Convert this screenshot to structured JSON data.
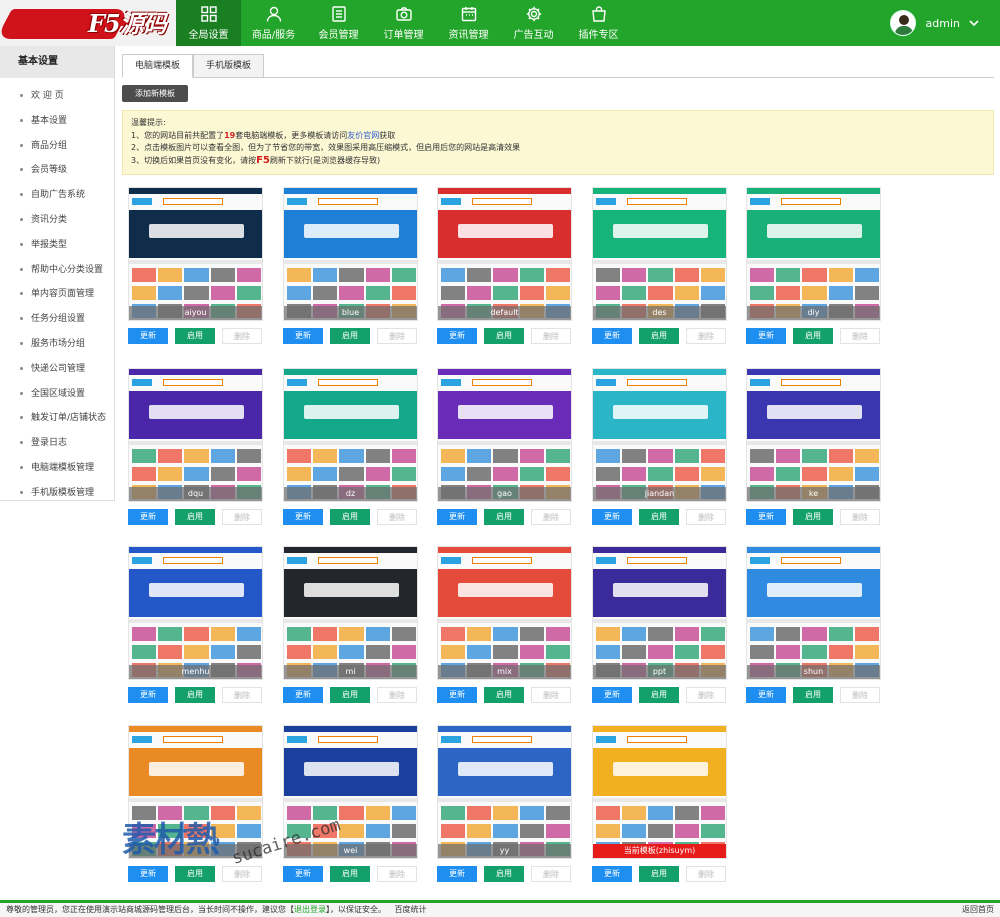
{
  "brand": {
    "logo_text": "F5源码"
  },
  "nav": [
    {
      "label": "全局设置",
      "icon": "grid-icon",
      "active": true
    },
    {
      "label": "商品/服务",
      "icon": "user-icon",
      "active": false
    },
    {
      "label": "会员管理",
      "icon": "document-list-icon",
      "active": false
    },
    {
      "label": "订单管理",
      "icon": "camera-icon",
      "active": false
    },
    {
      "label": "资讯管理",
      "icon": "calendar-icon",
      "active": false
    },
    {
      "label": "广告互动",
      "icon": "gear-icon",
      "active": false
    },
    {
      "label": "插件专区",
      "icon": "shopping-bag-icon",
      "active": false
    }
  ],
  "user": {
    "name": "admin"
  },
  "sidebar": {
    "title": "基本设置",
    "items": [
      "欢 迎 页",
      "基本设置",
      "商品分组",
      "会员等级",
      "自助广告系统",
      "资讯分类",
      "举报类型",
      "帮助中心分类设置",
      "单内容页面管理",
      "任务分组设置",
      "服务市场分组",
      "快递公司管理",
      "全国区域设置",
      "触发订单/店铺状态",
      "登录日志",
      "电脑端模板管理",
      "手机版模板管理"
    ]
  },
  "tabs": [
    "电脑端模板",
    "手机版模板"
  ],
  "add_button": "添加新模板",
  "tips": {
    "title": "温馨提示:",
    "l1_a": "1、您的网站目前共配置了",
    "l1_count": "19",
    "l1_b": "套电脑端模板，更多模板请访问",
    "l1_link": "友价官网",
    "l1_c": "获取",
    "l2": "2、点击模板图片可以查看全图，但为了节省您的带宽，效果图采用高压缩模式，但启用后您的网站是高清效果",
    "l3_a": "3、切换后如果首页没有变化，请按",
    "l3_key": "F5",
    "l3_b": "刷新下就行(是浏览器缓存导致)"
  },
  "buttons": {
    "update": "更新",
    "enable": "启用",
    "delete": "删除"
  },
  "templates": [
    {
      "name": "aiyou",
      "current": false,
      "color": "#0f2d4a"
    },
    {
      "name": "blue",
      "current": false,
      "color": "#1e7fd6"
    },
    {
      "name": "default",
      "current": false,
      "color": "#d92e2e"
    },
    {
      "name": "des",
      "current": false,
      "color": "#16b37a"
    },
    {
      "name": "diy",
      "current": false,
      "color": "#19b07a"
    },
    {
      "name": "dqu",
      "current": false,
      "color": "#4a26a8"
    },
    {
      "name": "dz",
      "current": false,
      "color": "#13a88a"
    },
    {
      "name": "gao",
      "current": false,
      "color": "#6a2bb8"
    },
    {
      "name": "jiandan",
      "current": false,
      "color": "#2bb6c8"
    },
    {
      "name": "ke",
      "current": false,
      "color": "#3a36b0"
    },
    {
      "name": "menhu",
      "current": false,
      "color": "#2458c8"
    },
    {
      "name": "mi",
      "current": false,
      "color": "#23262c"
    },
    {
      "name": "mix",
      "current": false,
      "color": "#e44b3a"
    },
    {
      "name": "ppt",
      "current": false,
      "color": "#3a2a9a"
    },
    {
      "name": "shun",
      "current": false,
      "color": "#2f8ae0"
    },
    {
      "name": "",
      "current": false,
      "color": "#e98a24"
    },
    {
      "name": "wei",
      "current": false,
      "color": "#1a3f9c"
    },
    {
      "name": "yy",
      "current": false,
      "color": "#2d65c4"
    },
    {
      "name": "当前模板(zhisuym)",
      "current": true,
      "color": "#f0b020"
    }
  ],
  "watermark": {
    "cn": "素材熱",
    "en": "sucaire.com"
  },
  "footer": {
    "text_a": "尊敬的管理员，您正在使用演示站商城源码管理后台，当长时间不操作，建议您【",
    "logout": "退出登录",
    "text_b": "】，以保证安全。",
    "stats": "百度统计",
    "home": "返回首页"
  },
  "colors": {
    "primary": "#23a42a",
    "nav_active": "#1a7f20",
    "update": "#1e8ff0",
    "enable": "#13a06a",
    "current": "#e81b1b"
  }
}
